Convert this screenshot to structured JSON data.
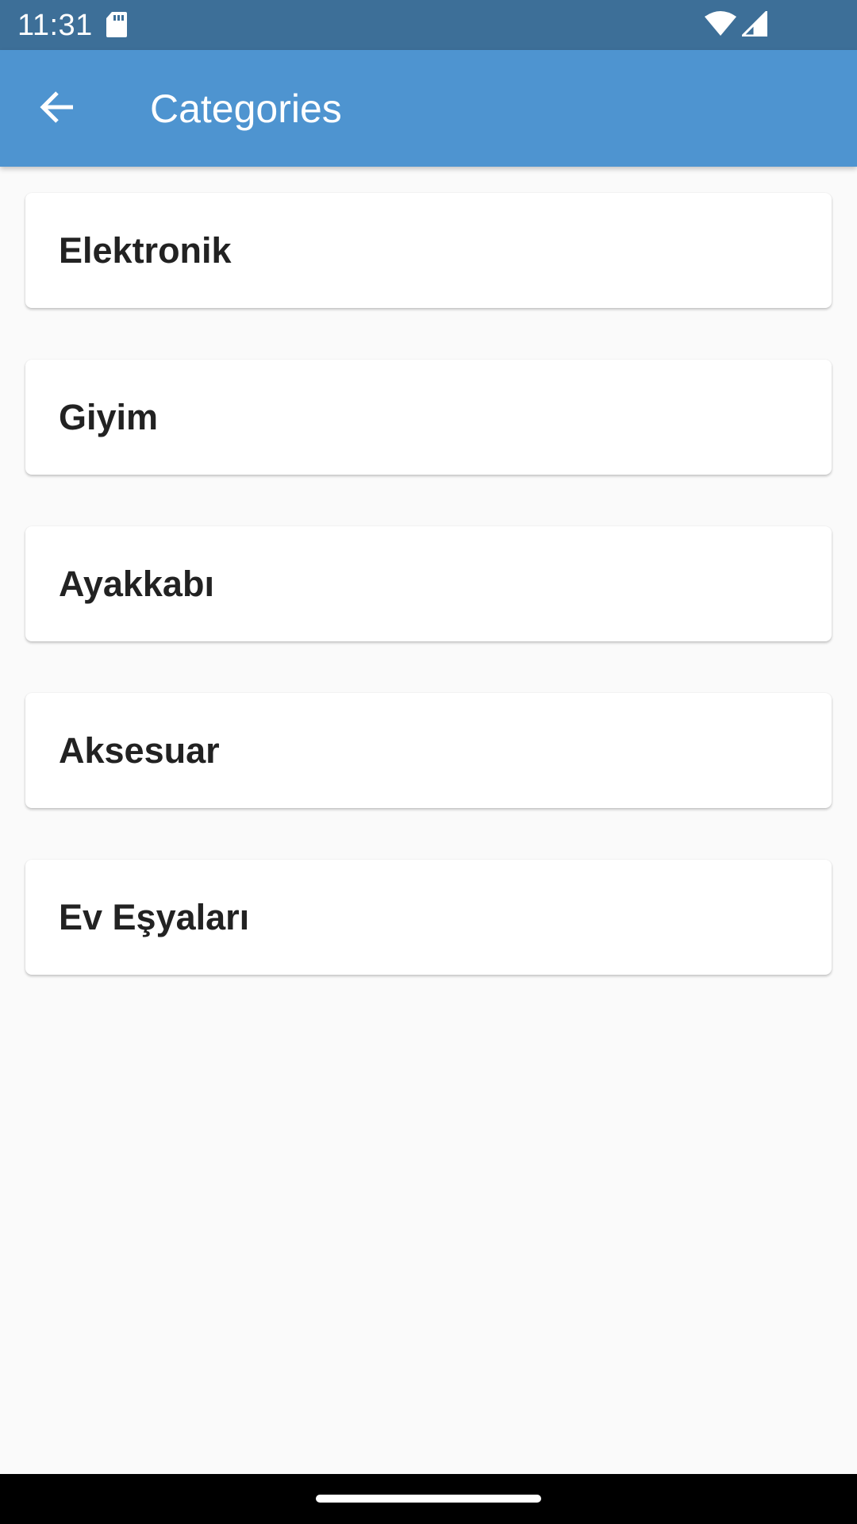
{
  "status_bar": {
    "time": "11:31",
    "icons": [
      "sd-card-icon",
      "wifi-icon",
      "cell-signal-icon"
    ]
  },
  "app_bar": {
    "back_icon": "arrow-left-icon",
    "title": "Categories"
  },
  "categories": [
    {
      "label": "Elektronik"
    },
    {
      "label": "Giyim"
    },
    {
      "label": "Ayakkabı"
    },
    {
      "label": "Aksesuar"
    },
    {
      "label": "Ev Eşyaları"
    }
  ],
  "colors": {
    "status_bar": "#3d6f98",
    "app_bar": "#4e94d0",
    "background": "#fafafa",
    "card": "#ffffff",
    "card_text": "#222222"
  }
}
